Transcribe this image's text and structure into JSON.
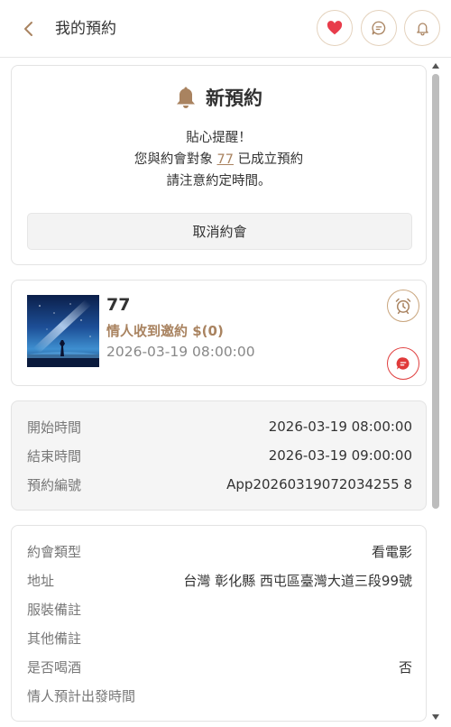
{
  "header": {
    "title": "我的預約",
    "buttons": {
      "heart_icon": "heart-icon",
      "chat_icon": "chat-icon",
      "bell_icon": "bell-icon",
      "heart_color": "#e83c4b",
      "accent_color": "#a98360"
    }
  },
  "reminder": {
    "title": "新預約",
    "line1": "貼心提醒！",
    "line2_prefix": "您與約會對象",
    "partner_name": "77",
    "line2_suffix": "已成立預約",
    "line3": "請注意約定時間。",
    "cancel_label": "取消約會"
  },
  "partner": {
    "name": "77",
    "status": "情人收到邀約 $(0)",
    "datetime": "2026-03-19 08:00:00"
  },
  "time_info": {
    "rows": [
      {
        "label": "開始時間",
        "value": "2026-03-19 08:00:00"
      },
      {
        "label": "結束時間",
        "value": "2026-03-19 09:00:00"
      },
      {
        "label": "預約編號",
        "value": "App20260319072034255 8"
      }
    ]
  },
  "details": {
    "rows": [
      {
        "label": "約會類型",
        "value": "看電影"
      },
      {
        "label": "地址",
        "value": "台灣 彰化縣 西屯區臺灣大道三段99號"
      },
      {
        "label": "服裝備註",
        "value": ""
      },
      {
        "label": "其他備註",
        "value": ""
      },
      {
        "label": "是否喝酒",
        "value": "否"
      },
      {
        "label": "情人預計出發時間",
        "value": ""
      }
    ]
  }
}
